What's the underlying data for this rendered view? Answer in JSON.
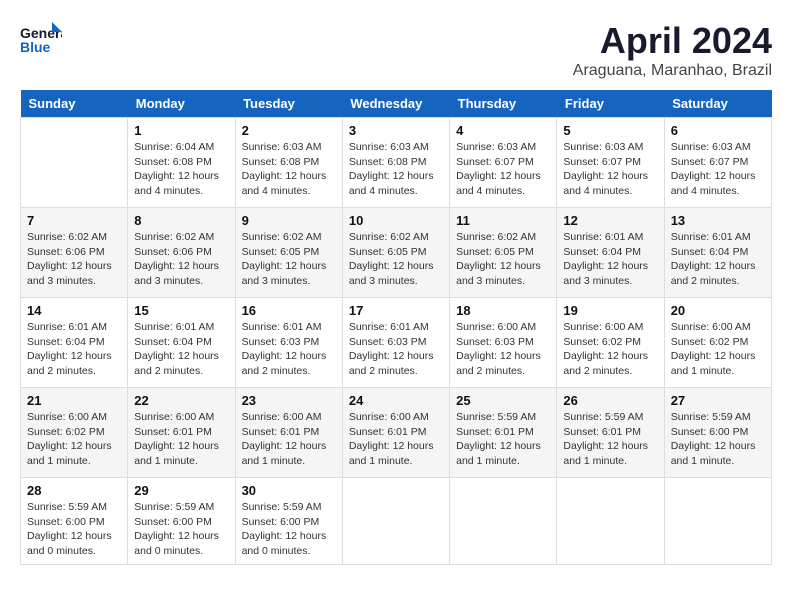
{
  "header": {
    "logo_general": "General",
    "logo_blue": "Blue",
    "month_year": "April 2024",
    "location": "Araguana, Maranhao, Brazil"
  },
  "weekdays": [
    "Sunday",
    "Monday",
    "Tuesday",
    "Wednesday",
    "Thursday",
    "Friday",
    "Saturday"
  ],
  "weeks": [
    [
      {
        "day": "",
        "info": ""
      },
      {
        "day": "1",
        "info": "Sunrise: 6:04 AM\nSunset: 6:08 PM\nDaylight: 12 hours\nand 4 minutes."
      },
      {
        "day": "2",
        "info": "Sunrise: 6:03 AM\nSunset: 6:08 PM\nDaylight: 12 hours\nand 4 minutes."
      },
      {
        "day": "3",
        "info": "Sunrise: 6:03 AM\nSunset: 6:08 PM\nDaylight: 12 hours\nand 4 minutes."
      },
      {
        "day": "4",
        "info": "Sunrise: 6:03 AM\nSunset: 6:07 PM\nDaylight: 12 hours\nand 4 minutes."
      },
      {
        "day": "5",
        "info": "Sunrise: 6:03 AM\nSunset: 6:07 PM\nDaylight: 12 hours\nand 4 minutes."
      },
      {
        "day": "6",
        "info": "Sunrise: 6:03 AM\nSunset: 6:07 PM\nDaylight: 12 hours\nand 4 minutes."
      }
    ],
    [
      {
        "day": "7",
        "info": "Sunrise: 6:02 AM\nSunset: 6:06 PM\nDaylight: 12 hours\nand 3 minutes."
      },
      {
        "day": "8",
        "info": "Sunrise: 6:02 AM\nSunset: 6:06 PM\nDaylight: 12 hours\nand 3 minutes."
      },
      {
        "day": "9",
        "info": "Sunrise: 6:02 AM\nSunset: 6:05 PM\nDaylight: 12 hours\nand 3 minutes."
      },
      {
        "day": "10",
        "info": "Sunrise: 6:02 AM\nSunset: 6:05 PM\nDaylight: 12 hours\nand 3 minutes."
      },
      {
        "day": "11",
        "info": "Sunrise: 6:02 AM\nSunset: 6:05 PM\nDaylight: 12 hours\nand 3 minutes."
      },
      {
        "day": "12",
        "info": "Sunrise: 6:01 AM\nSunset: 6:04 PM\nDaylight: 12 hours\nand 3 minutes."
      },
      {
        "day": "13",
        "info": "Sunrise: 6:01 AM\nSunset: 6:04 PM\nDaylight: 12 hours\nand 2 minutes."
      }
    ],
    [
      {
        "day": "14",
        "info": "Sunrise: 6:01 AM\nSunset: 6:04 PM\nDaylight: 12 hours\nand 2 minutes."
      },
      {
        "day": "15",
        "info": "Sunrise: 6:01 AM\nSunset: 6:04 PM\nDaylight: 12 hours\nand 2 minutes."
      },
      {
        "day": "16",
        "info": "Sunrise: 6:01 AM\nSunset: 6:03 PM\nDaylight: 12 hours\nand 2 minutes."
      },
      {
        "day": "17",
        "info": "Sunrise: 6:01 AM\nSunset: 6:03 PM\nDaylight: 12 hours\nand 2 minutes."
      },
      {
        "day": "18",
        "info": "Sunrise: 6:00 AM\nSunset: 6:03 PM\nDaylight: 12 hours\nand 2 minutes."
      },
      {
        "day": "19",
        "info": "Sunrise: 6:00 AM\nSunset: 6:02 PM\nDaylight: 12 hours\nand 2 minutes."
      },
      {
        "day": "20",
        "info": "Sunrise: 6:00 AM\nSunset: 6:02 PM\nDaylight: 12 hours\nand 1 minute."
      }
    ],
    [
      {
        "day": "21",
        "info": "Sunrise: 6:00 AM\nSunset: 6:02 PM\nDaylight: 12 hours\nand 1 minute."
      },
      {
        "day": "22",
        "info": "Sunrise: 6:00 AM\nSunset: 6:01 PM\nDaylight: 12 hours\nand 1 minute."
      },
      {
        "day": "23",
        "info": "Sunrise: 6:00 AM\nSunset: 6:01 PM\nDaylight: 12 hours\nand 1 minute."
      },
      {
        "day": "24",
        "info": "Sunrise: 6:00 AM\nSunset: 6:01 PM\nDaylight: 12 hours\nand 1 minute."
      },
      {
        "day": "25",
        "info": "Sunrise: 5:59 AM\nSunset: 6:01 PM\nDaylight: 12 hours\nand 1 minute."
      },
      {
        "day": "26",
        "info": "Sunrise: 5:59 AM\nSunset: 6:01 PM\nDaylight: 12 hours\nand 1 minute."
      },
      {
        "day": "27",
        "info": "Sunrise: 5:59 AM\nSunset: 6:00 PM\nDaylight: 12 hours\nand 1 minute."
      }
    ],
    [
      {
        "day": "28",
        "info": "Sunrise: 5:59 AM\nSunset: 6:00 PM\nDaylight: 12 hours\nand 0 minutes."
      },
      {
        "day": "29",
        "info": "Sunrise: 5:59 AM\nSunset: 6:00 PM\nDaylight: 12 hours\nand 0 minutes."
      },
      {
        "day": "30",
        "info": "Sunrise: 5:59 AM\nSunset: 6:00 PM\nDaylight: 12 hours\nand 0 minutes."
      },
      {
        "day": "",
        "info": ""
      },
      {
        "day": "",
        "info": ""
      },
      {
        "day": "",
        "info": ""
      },
      {
        "day": "",
        "info": ""
      }
    ]
  ]
}
